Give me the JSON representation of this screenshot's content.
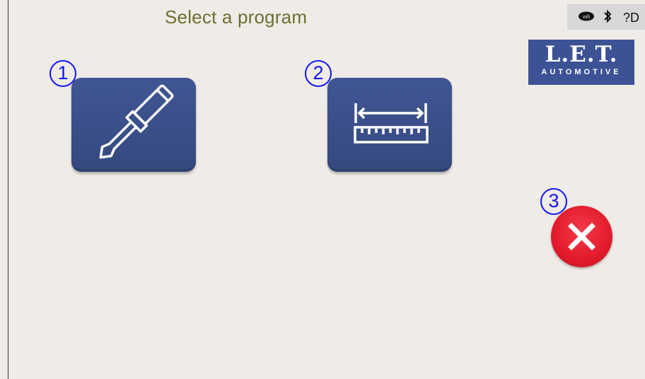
{
  "header": {
    "title": "Select a program"
  },
  "status_bar": {
    "wifi_icon": "wifi-icon",
    "bluetooth_icon": "bluetooth-icon",
    "help_text": "?D"
  },
  "logo": {
    "line1": "L.E.T.",
    "line2": "AUTOMOTIVE"
  },
  "programs": [
    {
      "number": "1",
      "icon": "screwdriver-icon"
    },
    {
      "number": "2",
      "icon": "measure-ruler-icon"
    }
  ],
  "exit": {
    "number": "3",
    "icon": "close-icon"
  },
  "colors": {
    "tile": "#3d5294",
    "badge": "#1414ee",
    "exit": "#e21b2c",
    "title": "#6e6e34",
    "background": "#efebe6"
  }
}
